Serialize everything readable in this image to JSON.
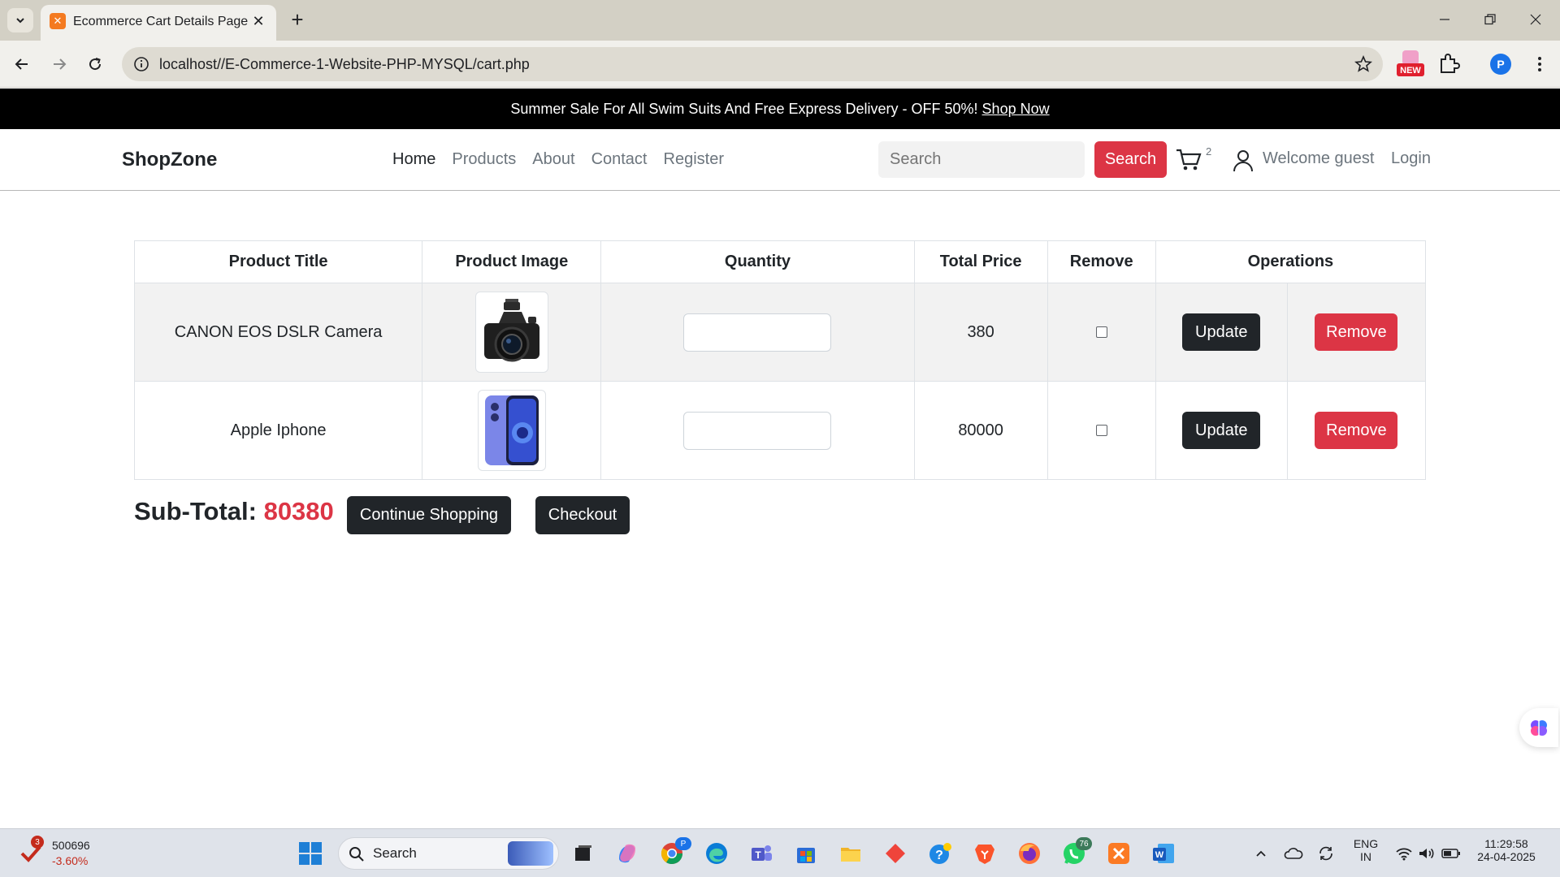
{
  "browser": {
    "tab_title": "Ecommerce Cart Details Page",
    "url": "localhost//E-Commerce-1-Website-PHP-MYSQL/cart.php",
    "profile_initial": "P",
    "ext_new_label": "NEW"
  },
  "promo": {
    "text": "Summer Sale For All Swim Suits And Free Express Delivery - OFF 50%!",
    "link": "Shop Now"
  },
  "nav": {
    "brand": "ShopZone",
    "links": [
      "Home",
      "Products",
      "About",
      "Contact",
      "Register"
    ],
    "search_placeholder": "Search",
    "search_button": "Search",
    "cart_count": "2",
    "welcome": "Welcome guest",
    "login": "Login"
  },
  "cart": {
    "headers": [
      "Product Title",
      "Product Image",
      "Quantity",
      "Total Price",
      "Remove",
      "Operations"
    ],
    "rows": [
      {
        "title": "CANON EOS DSLR Camera",
        "image": "camera-image",
        "quantity": "",
        "total_price": "380",
        "remove_checked": false,
        "update_label": "Update",
        "remove_label": "Remove"
      },
      {
        "title": "Apple Iphone",
        "image": "phone-image",
        "quantity": "",
        "total_price": "80000",
        "remove_checked": false,
        "update_label": "Update",
        "remove_label": "Remove"
      }
    ],
    "subtotal_label": "Sub-Total:",
    "subtotal_value": "80380",
    "continue_label": "Continue Shopping",
    "checkout_label": "Checkout"
  },
  "taskbar": {
    "stock_value": "500696",
    "stock_change": "-3.60%",
    "stock_badge": "3",
    "search_label": "Search",
    "chrome_badge": "P",
    "whatsapp_badge": "76",
    "lang_line1": "ENG",
    "lang_line2": "IN",
    "time": "11:29:58",
    "date": "24-04-2025"
  },
  "colors": {
    "accent_red": "#dc3545",
    "dark_button": "#212529",
    "promo_bg": "#000000"
  }
}
